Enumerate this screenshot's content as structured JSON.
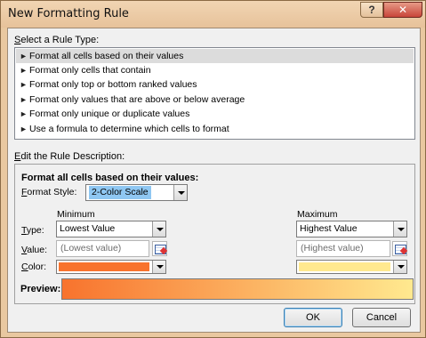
{
  "window": {
    "title": "New Formatting Rule",
    "help_label": "?",
    "close_label": "✕"
  },
  "rule_type": {
    "label_prefix": "S",
    "label_rest": "elect a Rule Type:",
    "items": [
      {
        "label": "Format all cells based on their values",
        "selected": true
      },
      {
        "label": "Format only cells that contain",
        "selected": false
      },
      {
        "label": "Format only top or bottom ranked values",
        "selected": false
      },
      {
        "label": "Format only values that are above or below average",
        "selected": false
      },
      {
        "label": "Format only unique or duplicate values",
        "selected": false
      },
      {
        "label": "Use a formula to determine which cells to format",
        "selected": false
      }
    ]
  },
  "description": {
    "label_prefix": "E",
    "label_rest": "dit the Rule Description:",
    "heading": "Format all cells based on their values:",
    "format_style_prefix": "F",
    "format_style_rest": "ormat Style:",
    "format_style_value": "2-Color Scale",
    "minimum_header": "Minimum",
    "maximum_header": "Maximum",
    "type_prefix": "T",
    "type_rest": "ype:",
    "value_prefix": "V",
    "value_rest": "alue:",
    "color_prefix": "C",
    "color_rest": "olor:",
    "min_type": "Lowest Value",
    "max_type": "Highest Value",
    "min_value": "(Lowest value)",
    "max_value": "(Highest value)",
    "preview_label": "Preview:"
  },
  "colors": {
    "min_color": "#f8732d",
    "max_color": "#ffe98f",
    "selection_blue": "#8fc7f2"
  },
  "buttons": {
    "ok_label": "OK",
    "cancel_label": "Cancel"
  }
}
